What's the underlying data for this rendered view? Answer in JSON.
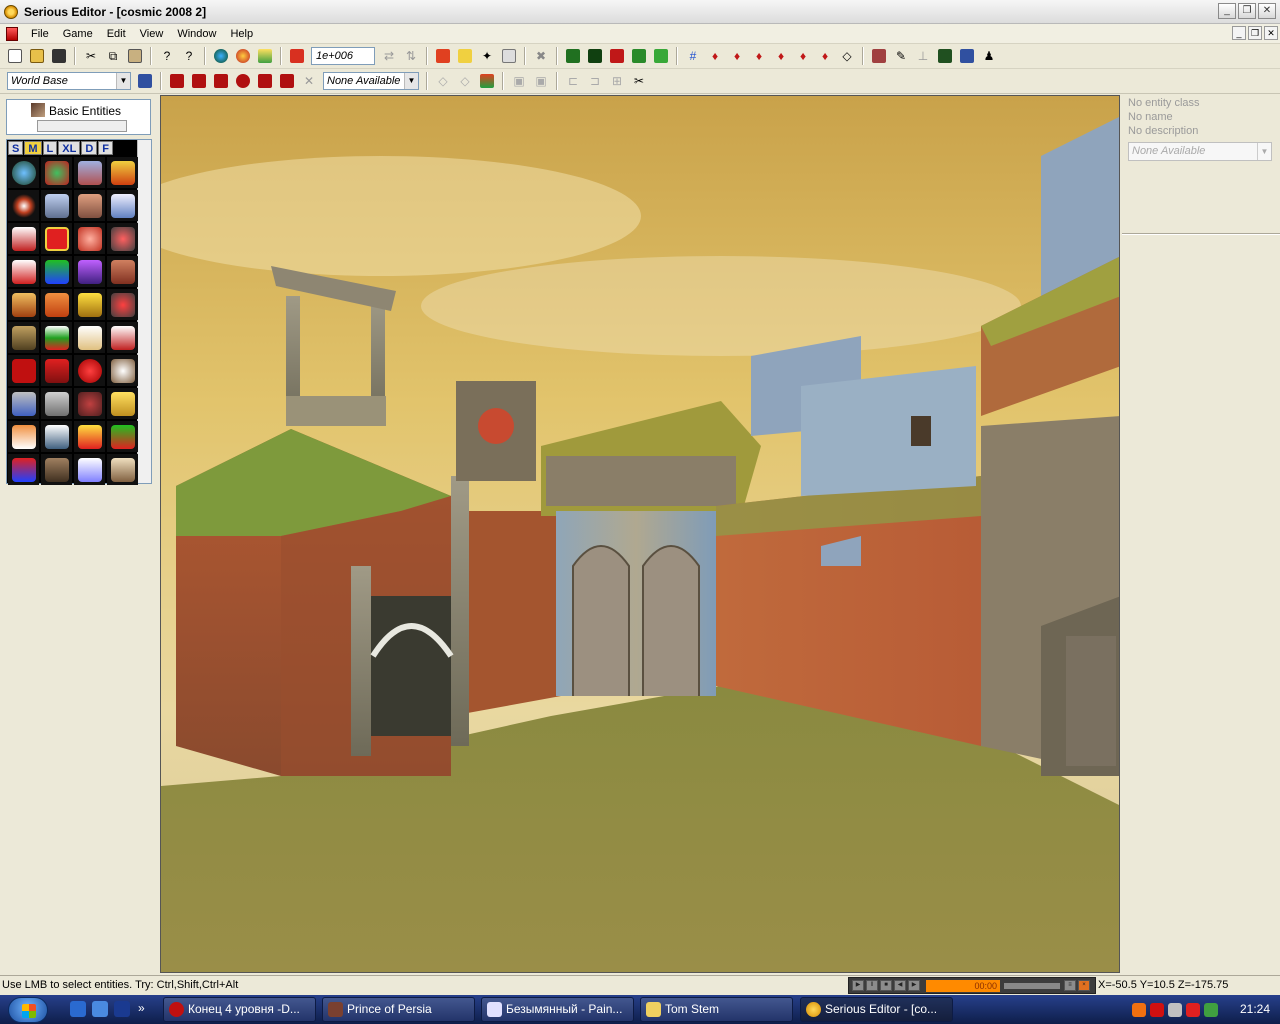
{
  "window": {
    "title": "Serious Editor - [cosmic 2008 2]"
  },
  "menu": [
    "File",
    "Game",
    "Edit",
    "View",
    "Window",
    "Help"
  ],
  "toolbar": {
    "zoom_value": "1e+006",
    "world_base": "World Base",
    "none_available": "None Available"
  },
  "tree": {
    "label": "Basic Entities"
  },
  "palette": {
    "tabs": [
      "S",
      "M",
      "L",
      "XL",
      "D",
      "F"
    ]
  },
  "properties": {
    "entity_class": "No entity class",
    "name": "No name",
    "description": "No description",
    "combo_value": "None Available"
  },
  "status": {
    "hint": "Use LMB to select entities. Try: Ctrl,Shift,Ctrl+Alt",
    "coords": "X=-50.5 Y=10.5 Z=-175.75",
    "media_time": "00:00"
  },
  "taskbar": {
    "tasks": [
      {
        "label": "Конец 4 уровня -D..."
      },
      {
        "label": "Prince of Persia"
      },
      {
        "label": "Безымянный - Pain..."
      },
      {
        "label": "Tom Stem"
      },
      {
        "label": "Serious Editor - [co..."
      }
    ],
    "clock": "21:24"
  },
  "colors": {
    "sky": "#d8b25a",
    "grass": "#8a8a3c",
    "cliff": "#b8643a",
    "wood_blue": "#7f9cb8",
    "stone": "#8f8870"
  }
}
